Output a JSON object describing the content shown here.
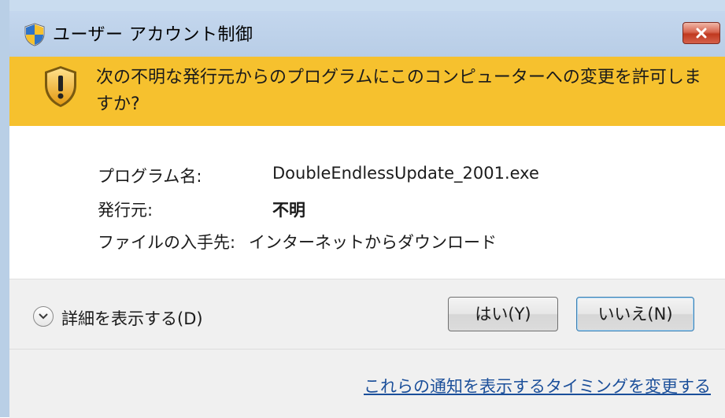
{
  "window": {
    "title": "ユーザー アカウント制御",
    "close_icon": "close-icon"
  },
  "banner": {
    "icon": "uac-shield-warning-icon",
    "message": "次の不明な発行元からのプログラムにこのコンピューターへの変更を許可しますか?"
  },
  "info": {
    "program_label": "プログラム名:",
    "program_value": "DoubleEndlessUpdate_2001.exe",
    "publisher_label": "発行元:",
    "publisher_value": "不明",
    "origin_label": "ファイルの入手先:",
    "origin_value": "インターネットからダウンロード"
  },
  "footer": {
    "details_label": "詳細を表示する(D)",
    "yes_label": "はい(Y)",
    "no_label": "いいえ(N)",
    "timing_link": "これらの通知を表示するタイミングを変更する"
  },
  "colors": {
    "banner": "#f6c12e",
    "link": "#1b4f9a",
    "close": "#c0391f"
  }
}
